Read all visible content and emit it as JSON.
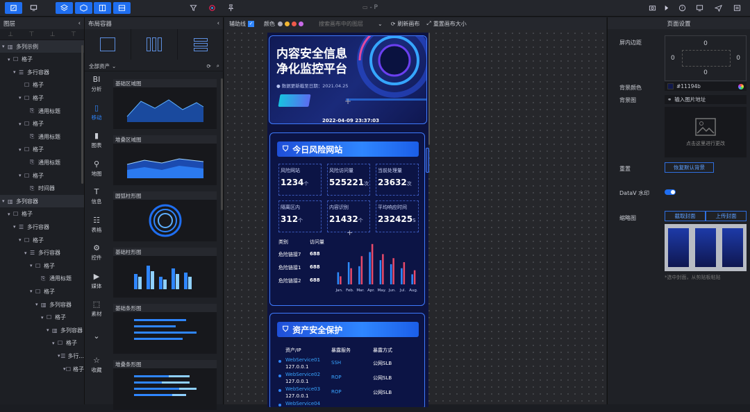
{
  "window": {
    "title": "- P"
  },
  "toolbar": {
    "icons_left": [
      "edit-icon",
      "monitor-icon",
      "layers-icon",
      "cube-icon",
      "panel-icon",
      "stack-icon"
    ],
    "icons_mid": [
      "filter-icon",
      "refresh-icon",
      "pin-icon"
    ],
    "icons_right": [
      "camera-icon",
      "play-icon",
      "help-icon",
      "display-icon",
      "send-icon",
      "menu-icon"
    ]
  },
  "tree": {
    "title": "图层",
    "items": [
      {
        "label": "多列示例",
        "icon": "columns",
        "indent": 0,
        "caret": true
      },
      {
        "label": "格子",
        "icon": "box",
        "indent": 1,
        "caret": true
      },
      {
        "label": "多行容器",
        "icon": "rows",
        "indent": 2,
        "caret": true
      },
      {
        "label": "格子",
        "icon": "box",
        "indent": 3,
        "caret": false
      },
      {
        "label": "格子",
        "icon": "box",
        "indent": 3,
        "caret": true
      },
      {
        "label": "通用标题",
        "icon": "title",
        "indent": 4,
        "caret": false
      },
      {
        "label": "格子",
        "icon": "box",
        "indent": 3,
        "caret": true
      },
      {
        "label": "通用标题",
        "icon": "title",
        "indent": 4,
        "caret": false
      },
      {
        "label": "格子",
        "icon": "box",
        "indent": 3,
        "caret": true
      },
      {
        "label": "通用标题",
        "icon": "title",
        "indent": 4,
        "caret": false
      },
      {
        "label": "格子",
        "icon": "box",
        "indent": 3,
        "caret": true
      },
      {
        "label": "时间器",
        "icon": "title",
        "indent": 4,
        "caret": false
      },
      {
        "label": "多列容器",
        "icon": "columns",
        "indent": 0,
        "caret": true
      },
      {
        "label": "格子",
        "icon": "box",
        "indent": 1,
        "caret": true
      },
      {
        "label": "多行容器",
        "icon": "rows",
        "indent": 2,
        "caret": true
      },
      {
        "label": "格子",
        "icon": "box",
        "indent": 3,
        "caret": true
      },
      {
        "label": "多行容器",
        "icon": "rows",
        "indent": 4,
        "caret": true
      },
      {
        "label": "格子",
        "icon": "box",
        "indent": 5,
        "caret": true
      },
      {
        "label": "通用标题",
        "icon": "title",
        "indent": 6,
        "caret": false
      },
      {
        "label": "格子",
        "icon": "box",
        "indent": 5,
        "caret": true
      },
      {
        "label": "多列容器",
        "icon": "columns",
        "indent": 6,
        "caret": true
      },
      {
        "label": "格子",
        "icon": "box",
        "indent": 7,
        "caret": true
      },
      {
        "label": "多列容器",
        "icon": "columns",
        "indent": 8,
        "caret": true
      },
      {
        "label": "格子",
        "icon": "box",
        "indent": 9,
        "caret": true
      },
      {
        "label": "多行...",
        "icon": "rows",
        "indent": 10,
        "caret": true
      },
      {
        "label": "格子",
        "icon": "box",
        "indent": 11,
        "caret": true
      }
    ]
  },
  "layout": {
    "title": "布局容器",
    "assets_label": "全部资产",
    "nav": [
      {
        "glyph": "BI",
        "label": "分析"
      },
      {
        "glyph": "▯",
        "label": "移动"
      },
      {
        "glyph": "▮",
        "label": "图表"
      },
      {
        "glyph": "⚲",
        "label": "地图"
      },
      {
        "glyph": "T",
        "label": "信息"
      },
      {
        "glyph": "☷",
        "label": "表格"
      },
      {
        "glyph": "⚙",
        "label": "控件"
      },
      {
        "glyph": "▶",
        "label": "媒体"
      },
      {
        "glyph": "⬚",
        "label": "素材"
      },
      {
        "glyph": "⌄",
        "label": ""
      },
      {
        "glyph": "☆",
        "label": "收藏"
      }
    ],
    "cards": [
      "基础区域图",
      "堆叠区域图",
      "圆弧柱形图",
      "基础柱形图",
      "基础条形图",
      "堆叠条形图"
    ]
  },
  "canvas_toolbar": {
    "guides_label": "辅助线",
    "color_label": "颜色",
    "search_placeholder": "搜索画布中的图层",
    "refresh_label": "刷新画布",
    "reset_label": "重置画布大小"
  },
  "phone": {
    "title_line1": "内容安全信息",
    "title_line2": "净化监控平台",
    "update_text": "数据更新截至日期：2021.04.25",
    "datetime": "2022-04-09 23:37:03",
    "section1_title": "今日风险网站",
    "stats": [
      {
        "label": "风险网站",
        "value": "1234",
        "unit": "个"
      },
      {
        "label": "风险访问量",
        "value": "525221",
        "unit": "次"
      },
      {
        "label": "当前处理量",
        "value": "23632",
        "unit": "次"
      },
      {
        "label": "隔离区内",
        "value": "312",
        "unit": "个"
      },
      {
        "label": "内容识别",
        "value": "21432",
        "unit": "个"
      },
      {
        "label": "平均响应时间",
        "value": "232425",
        "unit": "S"
      }
    ],
    "risk_table": {
      "headers": [
        "类别",
        "访问量"
      ],
      "rows": [
        [
          "危险链接7",
          "688"
        ],
        [
          "危险链接1",
          "688"
        ],
        [
          "危险链接2",
          "688"
        ]
      ]
    },
    "section2_title": "资产安全保护",
    "asset_table": {
      "headers": [
        "资产/IP",
        "暴露服务",
        "暴露方式"
      ],
      "rows": [
        [
          "WebService01",
          "127.0.0.1",
          "SSH",
          "公网SLB"
        ],
        [
          "WebService02",
          "127.0.0.1",
          "ROP",
          "公网SLB"
        ],
        [
          "WebService03",
          "127.0.0.1",
          "ROP",
          "公网SLB"
        ],
        [
          "WebService04",
          "",
          "",
          ""
        ]
      ]
    }
  },
  "chart_data": {
    "type": "bar",
    "categories": [
      "Jan.",
      "Feb.",
      "Mar.",
      "Apr.",
      "May.",
      "Jun.",
      "Jul.",
      "Aug."
    ],
    "series": [
      {
        "values": [
          6,
          11,
          9,
          16,
          12,
          10,
          8,
          5
        ],
        "color": "#2e8cff"
      },
      {
        "values": [
          4,
          8,
          14,
          20,
          15,
          13,
          11,
          7
        ],
        "color": "#e84a6a"
      }
    ],
    "ylim": [
      0,
      22
    ]
  },
  "props": {
    "title": "页面设置",
    "padding_label": "屏内边距",
    "padding": {
      "top": "0",
      "left": "0",
      "right": "0",
      "bottom": "0"
    },
    "bgcolor_label": "背景颜色",
    "bgcolor_value": "#11194b",
    "bgimage_label": "背景图",
    "bgimage_input": "输入图片地址",
    "upload_hint": "点击这里进行更改",
    "reset_label": "重置",
    "reset_button": "恢复默认背景",
    "watermark_label": "DataV 水印",
    "thumb_label": "缩略图",
    "capture_button": "截取封面",
    "upload_button": "上传封面",
    "thumb_hint": "*选中封面，从剪贴板粘贴"
  }
}
